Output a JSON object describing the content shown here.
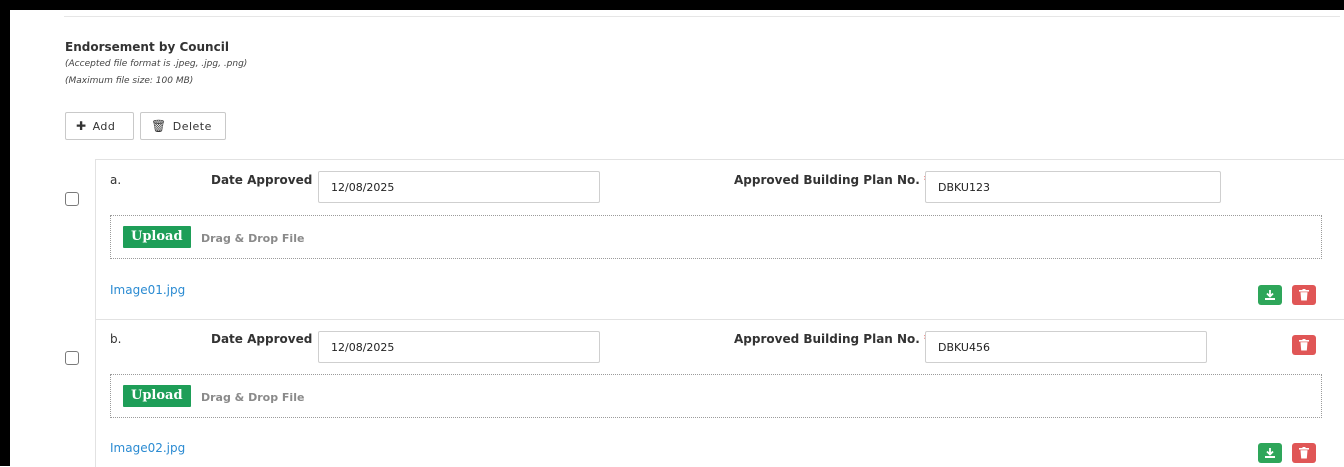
{
  "section": {
    "title": "Endorsement by Council",
    "note_format": "(Accepted file format is .jpeg, .jpg, .png)",
    "note_size": "(Maximum file size: 100 MB)"
  },
  "toolbar": {
    "add_label": "Add",
    "delete_label": "Delete"
  },
  "entries": [
    {
      "letter": "a.",
      "date_label": "Date Approved",
      "date_value": "12/08/2025",
      "plan_label": "Approved Building Plan No.",
      "required_mark": "*",
      "plan_value": "DBKU123",
      "upload_label": "Upload",
      "drop_text": "Drag & Drop File",
      "file_name": "Image01.jpg"
    },
    {
      "letter": "b.",
      "date_label": "Date Approved",
      "date_value": "12/08/2025",
      "plan_label": "Approved Building Plan No.",
      "required_mark": "*",
      "plan_value": "DBKU456",
      "upload_label": "Upload",
      "drop_text": "Drag & Drop File",
      "file_name": "Image02.jpg"
    }
  ],
  "colors": {
    "upload_green": "#1e9e58",
    "delete_red": "#e05656",
    "link_blue": "#2b8bd2",
    "required_red": "#e53935"
  },
  "icons": [
    "plus-icon",
    "trash-icon",
    "download-icon"
  ]
}
